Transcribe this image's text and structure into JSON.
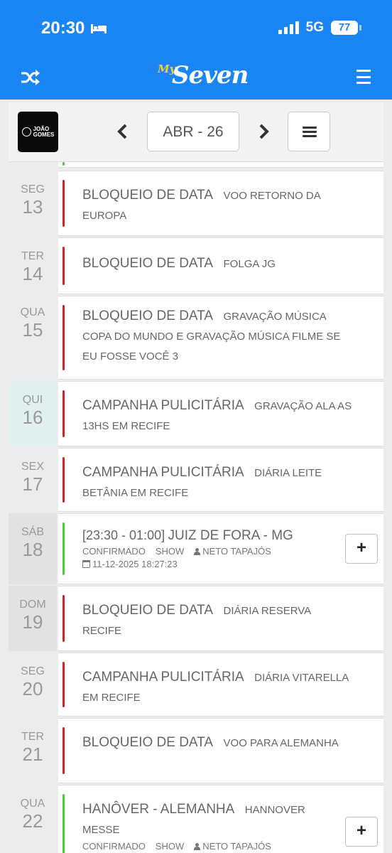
{
  "status_bar": {
    "time": "20:30",
    "network": "5G",
    "battery": "77"
  },
  "header": {
    "logo_my": "My",
    "logo_seven": "Seven"
  },
  "controls": {
    "month": "ABR - 26"
  },
  "colors": {
    "header_bg": "#1a86f5",
    "red": "#d0262b",
    "green": "#4cc93a",
    "today_bg": "#dff0ee"
  },
  "events": [
    {
      "day_name": "SEG",
      "day_num": "13",
      "title": "BLOQUEIO DE DATA",
      "detail": "VOO RETORNO DA EUROPA",
      "status": "red"
    },
    {
      "day_name": "TER",
      "day_num": "14",
      "title": "BLOQUEIO DE DATA",
      "detail": "FOLGA JG",
      "status": "red"
    },
    {
      "day_name": "QUA",
      "day_num": "15",
      "title": "BLOQUEIO DE DATA",
      "detail": "GRAVAÇÃO MÚSICA COPA DO MUNDO E GRAVAÇÃO MÚSICA FILME SE EU FOSSE VOCÊ 3",
      "status": "red"
    },
    {
      "day_name": "QUI",
      "day_num": "16",
      "title": "CAMPANHA PULICITÁRIA",
      "detail": "GRAVAÇÃO ALA AS 13HS EM RECIFE",
      "status": "red"
    },
    {
      "day_name": "SEX",
      "day_num": "17",
      "title": "CAMPANHA PULICITÁRIA",
      "detail": "DIÁRIA LEITE BETÂNIA EM RECIFE",
      "status": "red"
    },
    {
      "day_name": "SÁB",
      "day_num": "18",
      "time": "[23:30 - 01:00]",
      "title": "JUIZ DE FORA - MG",
      "confirmed": "CONFIRMADO",
      "type": "SHOW",
      "person": "NETO TAPAJÓS",
      "created": "11-12-2025 18:27:23",
      "status": "green",
      "add_label": "+"
    },
    {
      "day_name": "DOM",
      "day_num": "19",
      "title": "BLOQUEIO DE DATA",
      "detail": "DIÁRIA RESERVA RECIFE",
      "status": "red"
    },
    {
      "day_name": "SEG",
      "day_num": "20",
      "title": "CAMPANHA PULICITÁRIA",
      "detail": "DIÁRIA VITARELLA EM RECIFE",
      "status": "red"
    },
    {
      "day_name": "TER",
      "day_num": "21",
      "title": "BLOQUEIO DE DATA",
      "detail": "VOO PARA ALEMANHA",
      "status": "red"
    },
    {
      "day_name": "QUA",
      "day_num": "22",
      "title": "HANÔVER - ALEMANHA",
      "detail": "HANNOVER MESSE",
      "confirmed": "CONFIRMADO",
      "type": "SHOW",
      "person": "NETO TAPAJÓS",
      "status": "green",
      "add_label": "+"
    }
  ]
}
